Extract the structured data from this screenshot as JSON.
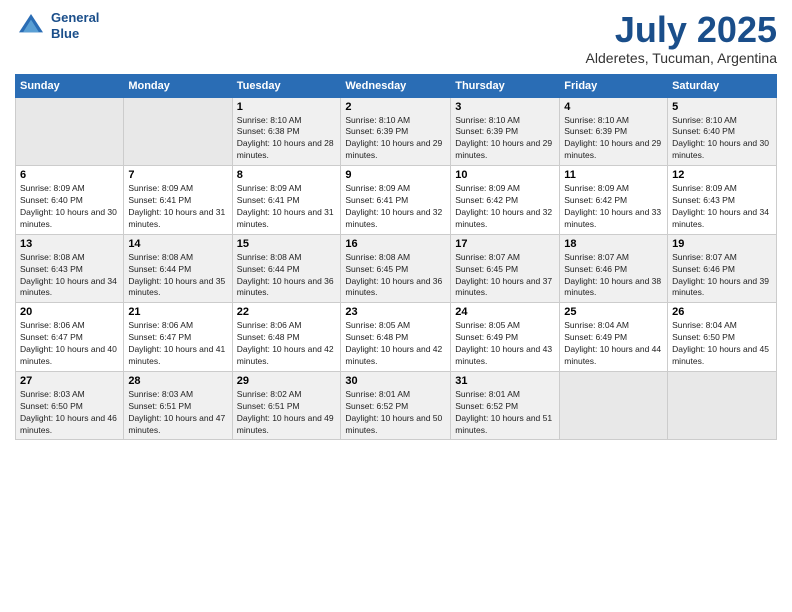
{
  "logo": {
    "line1": "General",
    "line2": "Blue"
  },
  "title": "July 2025",
  "location": "Alderetes, Tucuman, Argentina",
  "days_of_week": [
    "Sunday",
    "Monday",
    "Tuesday",
    "Wednesday",
    "Thursday",
    "Friday",
    "Saturday"
  ],
  "weeks": [
    [
      {
        "day": "",
        "sunrise": "",
        "sunset": "",
        "daylight": "",
        "empty": true
      },
      {
        "day": "",
        "sunrise": "",
        "sunset": "",
        "daylight": "",
        "empty": true
      },
      {
        "day": "1",
        "sunrise": "Sunrise: 8:10 AM",
        "sunset": "Sunset: 6:38 PM",
        "daylight": "Daylight: 10 hours and 28 minutes."
      },
      {
        "day": "2",
        "sunrise": "Sunrise: 8:10 AM",
        "sunset": "Sunset: 6:39 PM",
        "daylight": "Daylight: 10 hours and 29 minutes."
      },
      {
        "day": "3",
        "sunrise": "Sunrise: 8:10 AM",
        "sunset": "Sunset: 6:39 PM",
        "daylight": "Daylight: 10 hours and 29 minutes."
      },
      {
        "day": "4",
        "sunrise": "Sunrise: 8:10 AM",
        "sunset": "Sunset: 6:39 PM",
        "daylight": "Daylight: 10 hours and 29 minutes."
      },
      {
        "day": "5",
        "sunrise": "Sunrise: 8:10 AM",
        "sunset": "Sunset: 6:40 PM",
        "daylight": "Daylight: 10 hours and 30 minutes."
      }
    ],
    [
      {
        "day": "6",
        "sunrise": "Sunrise: 8:09 AM",
        "sunset": "Sunset: 6:40 PM",
        "daylight": "Daylight: 10 hours and 30 minutes."
      },
      {
        "day": "7",
        "sunrise": "Sunrise: 8:09 AM",
        "sunset": "Sunset: 6:41 PM",
        "daylight": "Daylight: 10 hours and 31 minutes."
      },
      {
        "day": "8",
        "sunrise": "Sunrise: 8:09 AM",
        "sunset": "Sunset: 6:41 PM",
        "daylight": "Daylight: 10 hours and 31 minutes."
      },
      {
        "day": "9",
        "sunrise": "Sunrise: 8:09 AM",
        "sunset": "Sunset: 6:41 PM",
        "daylight": "Daylight: 10 hours and 32 minutes."
      },
      {
        "day": "10",
        "sunrise": "Sunrise: 8:09 AM",
        "sunset": "Sunset: 6:42 PM",
        "daylight": "Daylight: 10 hours and 32 minutes."
      },
      {
        "day": "11",
        "sunrise": "Sunrise: 8:09 AM",
        "sunset": "Sunset: 6:42 PM",
        "daylight": "Daylight: 10 hours and 33 minutes."
      },
      {
        "day": "12",
        "sunrise": "Sunrise: 8:09 AM",
        "sunset": "Sunset: 6:43 PM",
        "daylight": "Daylight: 10 hours and 34 minutes."
      }
    ],
    [
      {
        "day": "13",
        "sunrise": "Sunrise: 8:08 AM",
        "sunset": "Sunset: 6:43 PM",
        "daylight": "Daylight: 10 hours and 34 minutes."
      },
      {
        "day": "14",
        "sunrise": "Sunrise: 8:08 AM",
        "sunset": "Sunset: 6:44 PM",
        "daylight": "Daylight: 10 hours and 35 minutes."
      },
      {
        "day": "15",
        "sunrise": "Sunrise: 8:08 AM",
        "sunset": "Sunset: 6:44 PM",
        "daylight": "Daylight: 10 hours and 36 minutes."
      },
      {
        "day": "16",
        "sunrise": "Sunrise: 8:08 AM",
        "sunset": "Sunset: 6:45 PM",
        "daylight": "Daylight: 10 hours and 36 minutes."
      },
      {
        "day": "17",
        "sunrise": "Sunrise: 8:07 AM",
        "sunset": "Sunset: 6:45 PM",
        "daylight": "Daylight: 10 hours and 37 minutes."
      },
      {
        "day": "18",
        "sunrise": "Sunrise: 8:07 AM",
        "sunset": "Sunset: 6:46 PM",
        "daylight": "Daylight: 10 hours and 38 minutes."
      },
      {
        "day": "19",
        "sunrise": "Sunrise: 8:07 AM",
        "sunset": "Sunset: 6:46 PM",
        "daylight": "Daylight: 10 hours and 39 minutes."
      }
    ],
    [
      {
        "day": "20",
        "sunrise": "Sunrise: 8:06 AM",
        "sunset": "Sunset: 6:47 PM",
        "daylight": "Daylight: 10 hours and 40 minutes."
      },
      {
        "day": "21",
        "sunrise": "Sunrise: 8:06 AM",
        "sunset": "Sunset: 6:47 PM",
        "daylight": "Daylight: 10 hours and 41 minutes."
      },
      {
        "day": "22",
        "sunrise": "Sunrise: 8:06 AM",
        "sunset": "Sunset: 6:48 PM",
        "daylight": "Daylight: 10 hours and 42 minutes."
      },
      {
        "day": "23",
        "sunrise": "Sunrise: 8:05 AM",
        "sunset": "Sunset: 6:48 PM",
        "daylight": "Daylight: 10 hours and 42 minutes."
      },
      {
        "day": "24",
        "sunrise": "Sunrise: 8:05 AM",
        "sunset": "Sunset: 6:49 PM",
        "daylight": "Daylight: 10 hours and 43 minutes."
      },
      {
        "day": "25",
        "sunrise": "Sunrise: 8:04 AM",
        "sunset": "Sunset: 6:49 PM",
        "daylight": "Daylight: 10 hours and 44 minutes."
      },
      {
        "day": "26",
        "sunrise": "Sunrise: 8:04 AM",
        "sunset": "Sunset: 6:50 PM",
        "daylight": "Daylight: 10 hours and 45 minutes."
      }
    ],
    [
      {
        "day": "27",
        "sunrise": "Sunrise: 8:03 AM",
        "sunset": "Sunset: 6:50 PM",
        "daylight": "Daylight: 10 hours and 46 minutes."
      },
      {
        "day": "28",
        "sunrise": "Sunrise: 8:03 AM",
        "sunset": "Sunset: 6:51 PM",
        "daylight": "Daylight: 10 hours and 47 minutes."
      },
      {
        "day": "29",
        "sunrise": "Sunrise: 8:02 AM",
        "sunset": "Sunset: 6:51 PM",
        "daylight": "Daylight: 10 hours and 49 minutes."
      },
      {
        "day": "30",
        "sunrise": "Sunrise: 8:01 AM",
        "sunset": "Sunset: 6:52 PM",
        "daylight": "Daylight: 10 hours and 50 minutes."
      },
      {
        "day": "31",
        "sunrise": "Sunrise: 8:01 AM",
        "sunset": "Sunset: 6:52 PM",
        "daylight": "Daylight: 10 hours and 51 minutes."
      },
      {
        "day": "",
        "sunrise": "",
        "sunset": "",
        "daylight": "",
        "empty": true
      },
      {
        "day": "",
        "sunrise": "",
        "sunset": "",
        "daylight": "",
        "empty": true
      }
    ]
  ]
}
